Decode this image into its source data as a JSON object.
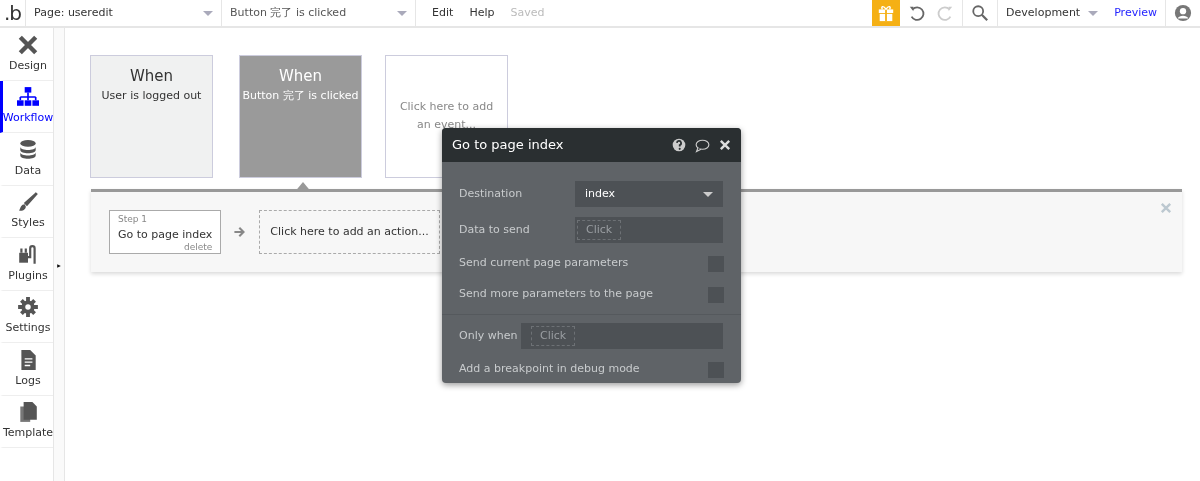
{
  "topbar": {
    "logo": ".b",
    "page_selector": "Page: useredit",
    "event_selector": "Button 完了 is clicked",
    "menu": [
      "Edit",
      "Help"
    ],
    "save_status": "Saved",
    "environment": "Development",
    "preview": "Preview"
  },
  "sidebar": {
    "items": [
      {
        "label": "Design",
        "selected": false
      },
      {
        "label": "Workflow",
        "selected": true
      },
      {
        "label": "Data",
        "selected": false
      },
      {
        "label": "Styles",
        "selected": false
      },
      {
        "label": "Plugins",
        "selected": false
      },
      {
        "label": "Settings",
        "selected": false
      },
      {
        "label": "Logs",
        "selected": false
      },
      {
        "label": "Template",
        "selected": false
      }
    ]
  },
  "events": [
    {
      "title": "When",
      "text": "User is logged out",
      "selected": false
    },
    {
      "title": "When",
      "text": "Button 完了 is clicked",
      "selected": true
    }
  ],
  "add_event": "Click here to add an event...",
  "steps": [
    {
      "step": "Step 1",
      "action": "Go to page index",
      "delete": "delete"
    }
  ],
  "add_action": "Click here to add an action...",
  "popup": {
    "title": "Go to page index",
    "fields": [
      {
        "kind": "select",
        "label": "Destination",
        "value": "index"
      },
      {
        "kind": "expression",
        "label": "Data to send",
        "placeholder": "Click"
      },
      {
        "kind": "checkbox",
        "label": "Send current page parameters",
        "checked": false
      },
      {
        "kind": "checkbox",
        "label": "Send more parameters to the page",
        "checked": false
      },
      {
        "kind": "divider"
      },
      {
        "kind": "inline-expression",
        "label": "Only when",
        "placeholder": "Click"
      },
      {
        "kind": "checkbox",
        "label": "Add a breakpoint in debug mode",
        "checked": false
      }
    ]
  }
}
